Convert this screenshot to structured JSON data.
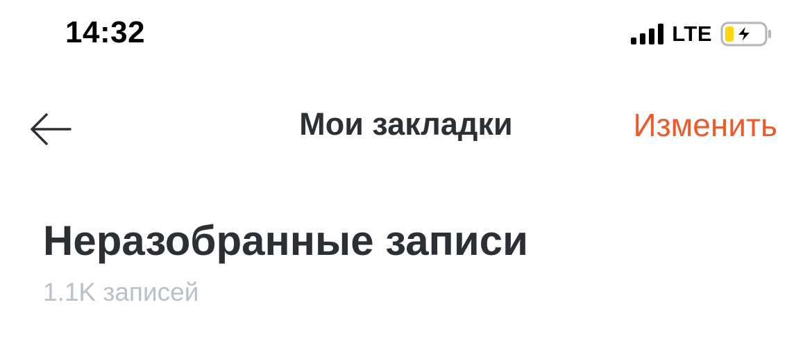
{
  "status_bar": {
    "time": "14:32",
    "network": "LTE",
    "signal_icon": "cellular-signal-icon",
    "battery_icon": "battery-charging-icon",
    "battery_level_color": "#ffd60a"
  },
  "nav": {
    "back_icon": "arrow-left-icon",
    "title": "Мои закладки",
    "edit_label": "Изменить",
    "accent_color": "#ee5a2a"
  },
  "section": {
    "title": "Неразобранные записи",
    "count": "1.1K записей"
  }
}
